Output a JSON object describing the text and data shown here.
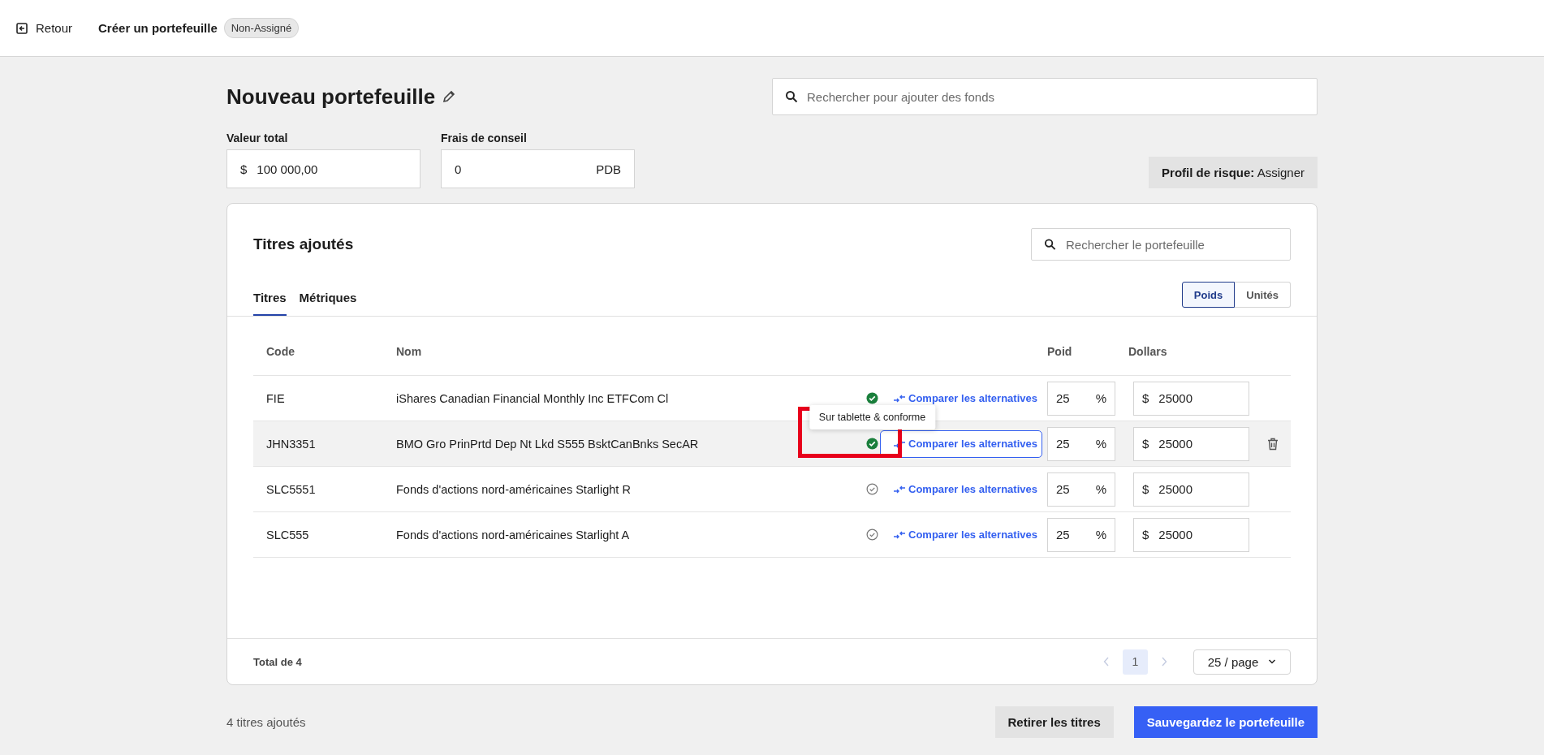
{
  "topbar": {
    "back": "Retour",
    "title": "Créer un portefeuille",
    "badge": "Non-Assigné"
  },
  "header": {
    "title": "Nouveau portefeuille",
    "search": {
      "placeholder": "Rechercher pour ajouter des fonds"
    }
  },
  "fields": [
    {
      "label": "Valeur total",
      "prefix": "$",
      "value": "100 000,00"
    },
    {
      "label": "Frais de conseil",
      "value": "0",
      "suffix": "PDB"
    }
  ],
  "risk_profile": {
    "label": "Profil de risque:",
    "value": "Assigner"
  },
  "card": {
    "title": "Titres ajoutés",
    "search": {
      "placeholder": "Rechercher le portefeuille"
    },
    "tabs": [
      {
        "label": "Titres",
        "selected": true
      },
      {
        "label": "Métriques",
        "selected": false
      }
    ],
    "toggle": [
      {
        "label": "Poids",
        "selected": true
      },
      {
        "label": "Unités",
        "selected": false
      }
    ],
    "table": {
      "columns": [
        "Code",
        "Nom",
        "Poid",
        "Dollars"
      ],
      "rows": [
        {
          "code": "FIE",
          "name": "iShares Canadian Financial Monthly Inc ETFCom Cl",
          "compliant": true,
          "compare": "Comparer les alternatives",
          "weight": "25",
          "weight_unit": "%",
          "currency": "$",
          "dollars": "25000",
          "highlighted": false
        },
        {
          "code": "JHN3351",
          "name": "BMO Gro PrinPrtd Dep Nt Lkd S555 BsktCanBnks SecAR",
          "compliant": true,
          "compare": "Comparer les alternatives",
          "weight": "25",
          "weight_unit": "%",
          "currency": "$",
          "dollars": "25000",
          "highlighted": true,
          "tooltip": "Sur tablette & conforme"
        },
        {
          "code": "SLC5551",
          "name": "Fonds d'actions nord-américaines Starlight R",
          "compliant": false,
          "compare": "Comparer les alternatives",
          "weight": "25",
          "weight_unit": "%",
          "currency": "$",
          "dollars": "25000",
          "highlighted": false
        },
        {
          "code": "SLC555",
          "name": "Fonds d'actions nord-américaines Starlight A",
          "compliant": false,
          "compare": "Comparer les alternatives",
          "weight": "25",
          "weight_unit": "%",
          "currency": "$",
          "dollars": "25000",
          "highlighted": false
        }
      ]
    },
    "footer": {
      "total": "Total de 4",
      "pages": [
        {
          "label": "1",
          "selected": true
        }
      ],
      "page_size": "25 / page"
    }
  },
  "bottom": {
    "count": "4 titres ajoutés",
    "buttons": [
      {
        "label": "Retirer les titres",
        "kind": "secondary"
      },
      {
        "label": "Sauvegardez le portefeuille",
        "kind": "primary"
      }
    ]
  }
}
